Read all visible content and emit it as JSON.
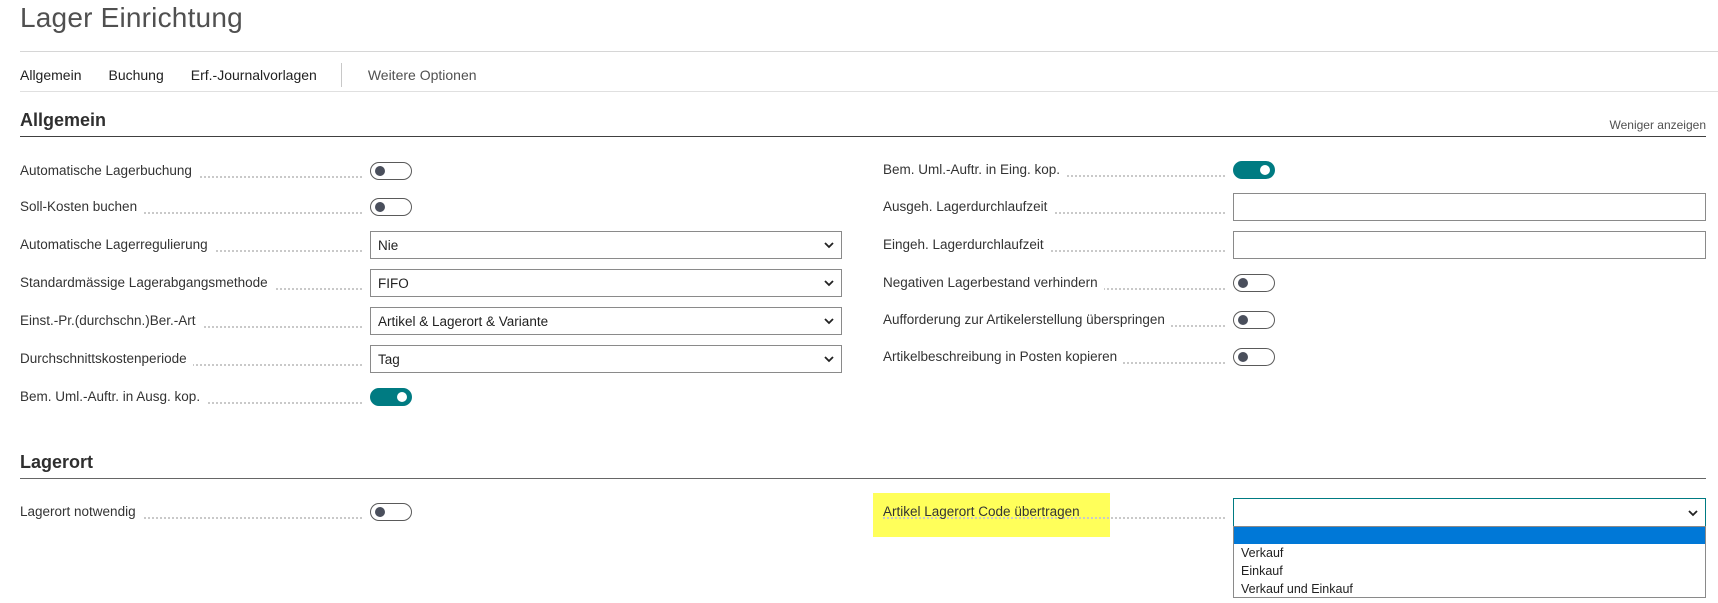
{
  "page": {
    "title": "Lager Einrichtung"
  },
  "actions": {
    "items": [
      "Allgemein",
      "Buchung",
      "Erf.-Journalvorlagen"
    ],
    "more": "Weitere Optionen"
  },
  "sections": {
    "general": {
      "title": "Allgemein",
      "less_link": "Weniger anzeigen"
    },
    "location": {
      "title": "Lagerort"
    }
  },
  "general_left": [
    {
      "label": "Automatische Lagerbuchung",
      "type": "toggle",
      "value": false
    },
    {
      "label": "Soll-Kosten buchen",
      "type": "toggle",
      "value": false
    },
    {
      "label": "Automatische Lagerregulierung",
      "type": "select",
      "value": "Nie"
    },
    {
      "label": "Standardmässige Lagerabgangsmethode",
      "type": "select",
      "value": "FIFO"
    },
    {
      "label": "Einst.-Pr.(durchschn.)Ber.-Art",
      "type": "select",
      "value": "Artikel & Lagerort & Variante"
    },
    {
      "label": "Durchschnittskostenperiode",
      "type": "select",
      "value": "Tag"
    },
    {
      "label": "Bem. Uml.-Auftr. in Ausg. kop.",
      "type": "toggle",
      "value": true
    }
  ],
  "general_right": [
    {
      "label": "Bem. Uml.-Auftr. in Eing. kop.",
      "type": "toggle",
      "value": true
    },
    {
      "label": "Ausgeh. Lagerdurchlaufzeit",
      "type": "text",
      "value": ""
    },
    {
      "label": "Eingeh. Lagerdurchlaufzeit",
      "type": "text",
      "value": ""
    },
    {
      "label": "Negativen Lagerbestand verhindern",
      "type": "toggle",
      "value": false
    },
    {
      "label": "Aufforderung zur Artikelerstellung überspringen",
      "type": "toggle",
      "value": false
    },
    {
      "label": "Artikelbeschreibung in Posten kopieren",
      "type": "toggle",
      "value": false
    }
  ],
  "location_left": [
    {
      "label": "Lagerort notwendig",
      "type": "toggle",
      "value": false
    }
  ],
  "location_right": {
    "label": "Artikel Lagerort Code übertragen",
    "value": "",
    "options": [
      "",
      "Verkauf",
      "Einkauf",
      "Verkauf und Einkauf"
    ],
    "highlight_color": "#ffff5a"
  },
  "colors": {
    "accent": "#007b82",
    "selection": "#0078d7"
  },
  "icons": {
    "dropdown": "chevron-down-icon"
  }
}
